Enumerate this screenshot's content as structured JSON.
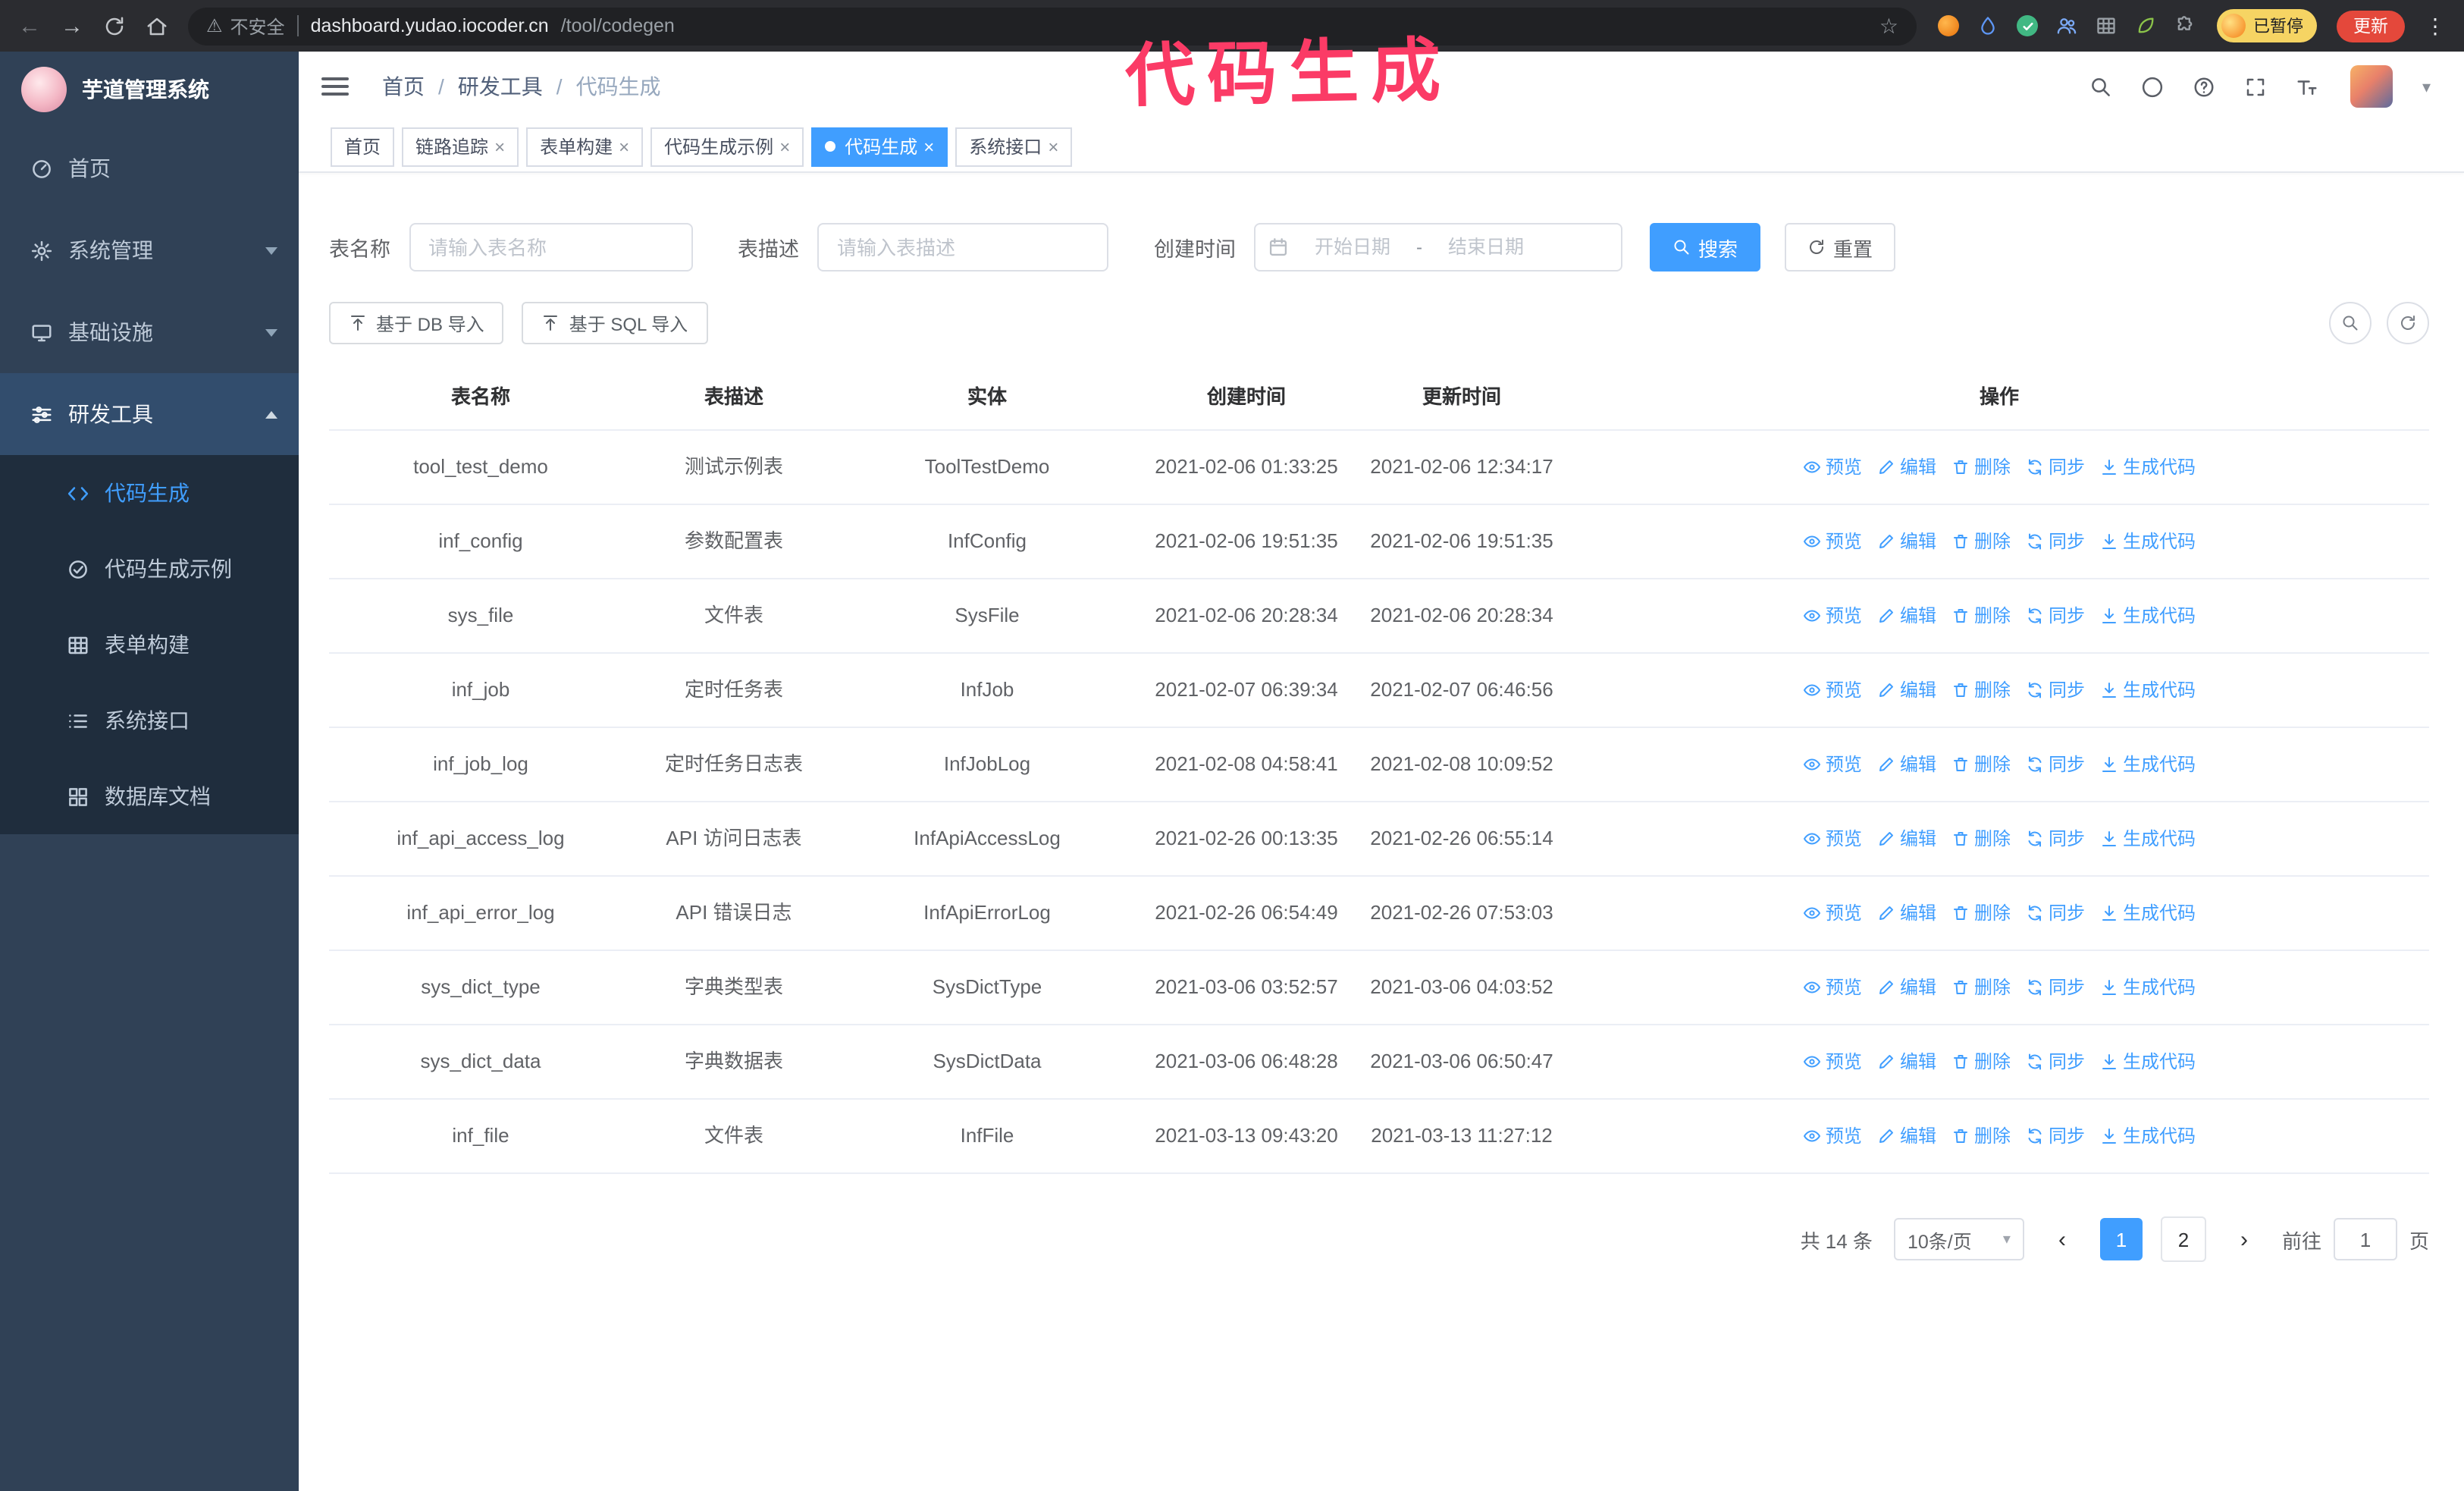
{
  "browser": {
    "security": "不安全",
    "url_host": "dashboard.yudao.iocoder.cn",
    "url_path": "/tool/codegen",
    "paused": "已暂停",
    "update": "更新"
  },
  "annotation": "代码生成",
  "icons": {
    "close": "×",
    "slash": "/",
    "star": "☆",
    "warning": "⚠",
    "back": "←",
    "forward": "→",
    "more": "⋮",
    "caret_down": "▾",
    "prev": "‹",
    "next": "›"
  },
  "colors": {
    "accent": "#409eff",
    "sidebar_bg": "#304156",
    "submenu_bg": "#1f2d3d",
    "annotation": "#fb3b66",
    "update_button_bg": "#e4483b",
    "paused_badge_bg": "#f6d463"
  },
  "sidebar": {
    "logo_title": "芋道管理系统",
    "items": [
      "首页",
      "系统管理",
      "基础设施",
      "研发工具"
    ],
    "sub_items": [
      "代码生成",
      "代码生成示例",
      "表单构建",
      "系统接口",
      "数据库文档"
    ]
  },
  "header": {
    "breadcrumb": [
      "首页",
      "研发工具",
      "代码生成"
    ]
  },
  "tags": [
    {
      "label": "首页"
    },
    {
      "label": "链路追踪"
    },
    {
      "label": "表单构建"
    },
    {
      "label": "代码生成示例"
    },
    {
      "label": "代码生成"
    },
    {
      "label": "系统接口"
    }
  ],
  "search": {
    "table_name_label": "表名称",
    "table_name_placeholder": "请输入表名称",
    "table_desc_label": "表描述",
    "table_desc_placeholder": "请输入表描述",
    "create_time_label": "创建时间",
    "date_start_placeholder": "开始日期",
    "date_separator": "-",
    "date_end_placeholder": "结束日期",
    "search_button": "搜索",
    "reset_button": "重置"
  },
  "toolbar": {
    "import_db": "基于 DB 导入",
    "import_sql": "基于 SQL 导入"
  },
  "table": {
    "columns": [
      "表名称",
      "表描述",
      "实体",
      "创建时间",
      "更新时间",
      "操作"
    ],
    "op_labels": {
      "preview": "预览",
      "edit": "编辑",
      "delete": "删除",
      "sync": "同步",
      "generate": "生成代码"
    },
    "rows": [
      {
        "name": "tool_test_demo",
        "desc": "测试示例表",
        "entity": "ToolTestDemo",
        "created": "2021-02-06 01:33:25",
        "updated": "2021-02-06 12:34:17"
      },
      {
        "name": "inf_config",
        "desc": "参数配置表",
        "entity": "InfConfig",
        "created": "2021-02-06 19:51:35",
        "updated": "2021-02-06 19:51:35"
      },
      {
        "name": "sys_file",
        "desc": "文件表",
        "entity": "SysFile",
        "created": "2021-02-06 20:28:34",
        "updated": "2021-02-06 20:28:34"
      },
      {
        "name": "inf_job",
        "desc": "定时任务表",
        "entity": "InfJob",
        "created": "2021-02-07 06:39:34",
        "updated": "2021-02-07 06:46:56"
      },
      {
        "name": "inf_job_log",
        "desc": "定时任务日志表",
        "entity": "InfJobLog",
        "created": "2021-02-08 04:58:41",
        "updated": "2021-02-08 10:09:52"
      },
      {
        "name": "inf_api_access_log",
        "desc": "API 访问日志表",
        "entity": "InfApiAccessLog",
        "created": "2021-02-26 00:13:35",
        "updated": "2021-02-26 06:55:14"
      },
      {
        "name": "inf_api_error_log",
        "desc": "API 错误日志",
        "entity": "InfApiErrorLog",
        "created": "2021-02-26 06:54:49",
        "updated": "2021-02-26 07:53:03"
      },
      {
        "name": "sys_dict_type",
        "desc": "字典类型表",
        "entity": "SysDictType",
        "created": "2021-03-06 03:52:57",
        "updated": "2021-03-06 04:03:52"
      },
      {
        "name": "sys_dict_data",
        "desc": "字典数据表",
        "entity": "SysDictData",
        "created": "2021-03-06 06:48:28",
        "updated": "2021-03-06 06:50:47"
      },
      {
        "name": "inf_file",
        "desc": "文件表",
        "entity": "InfFile",
        "created": "2021-03-13 09:43:20",
        "updated": "2021-03-13 11:27:12"
      }
    ]
  },
  "pagination": {
    "total": "共 14 条",
    "page_size": "10条/页",
    "pages": [
      "1",
      "2"
    ],
    "goto_label": "前往",
    "goto_value": "1",
    "page_unit": "页"
  }
}
